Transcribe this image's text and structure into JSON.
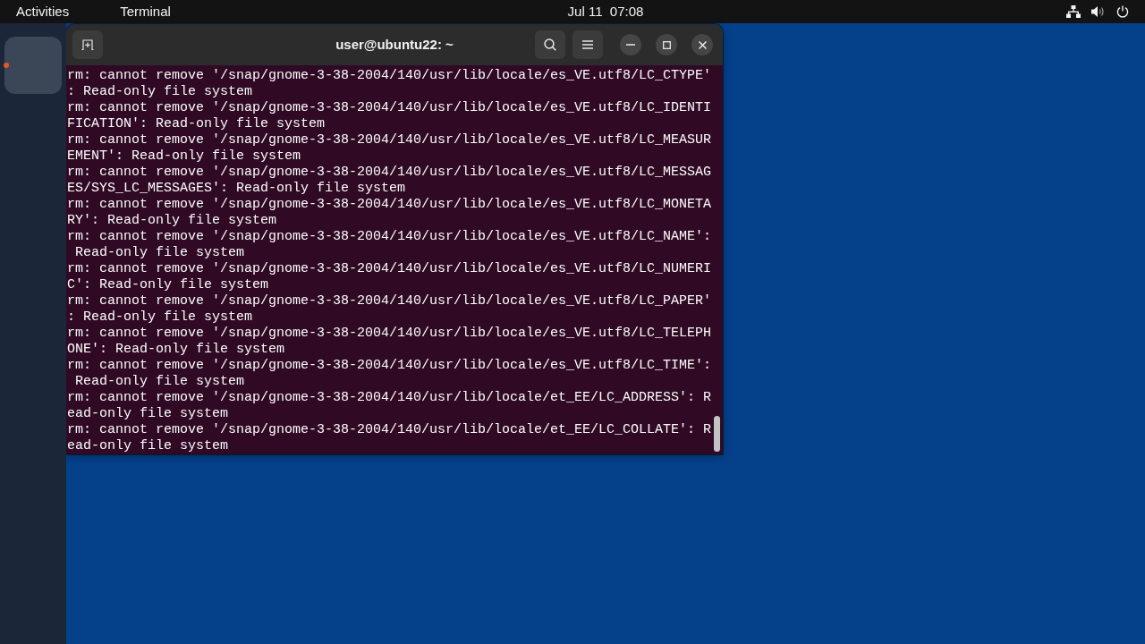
{
  "top_bar": {
    "activities": "Activities",
    "app_menu": "Terminal",
    "clock": "Jul 11  07:08"
  },
  "dock": {
    "apps": [
      {
        "selected": true,
        "running": true
      }
    ]
  },
  "terminal": {
    "title": "user@ubuntu22: ~",
    "lines": [
      "rm: cannot remove '/snap/gnome-3-38-2004/140/usr/lib/locale/es_VE.utf8/LC_CTYPE'",
      ": Read-only file system",
      "rm: cannot remove '/snap/gnome-3-38-2004/140/usr/lib/locale/es_VE.utf8/LC_IDENTI",
      "FICATION': Read-only file system",
      "rm: cannot remove '/snap/gnome-3-38-2004/140/usr/lib/locale/es_VE.utf8/LC_MEASUR",
      "EMENT': Read-only file system",
      "rm: cannot remove '/snap/gnome-3-38-2004/140/usr/lib/locale/es_VE.utf8/LC_MESSAG",
      "ES/SYS_LC_MESSAGES': Read-only file system",
      "rm: cannot remove '/snap/gnome-3-38-2004/140/usr/lib/locale/es_VE.utf8/LC_MONETA",
      "RY': Read-only file system",
      "rm: cannot remove '/snap/gnome-3-38-2004/140/usr/lib/locale/es_VE.utf8/LC_NAME':",
      " Read-only file system",
      "rm: cannot remove '/snap/gnome-3-38-2004/140/usr/lib/locale/es_VE.utf8/LC_NUMERI",
      "C': Read-only file system",
      "rm: cannot remove '/snap/gnome-3-38-2004/140/usr/lib/locale/es_VE.utf8/LC_PAPER'",
      ": Read-only file system",
      "rm: cannot remove '/snap/gnome-3-38-2004/140/usr/lib/locale/es_VE.utf8/LC_TELEPH",
      "ONE': Read-only file system",
      "rm: cannot remove '/snap/gnome-3-38-2004/140/usr/lib/locale/es_VE.utf8/LC_TIME':",
      " Read-only file system",
      "rm: cannot remove '/snap/gnome-3-38-2004/140/usr/lib/locale/et_EE/LC_ADDRESS': R",
      "ead-only file system",
      "rm: cannot remove '/snap/gnome-3-38-2004/140/usr/lib/locale/et_EE/LC_COLLATE': R",
      "ead-only file system"
    ]
  }
}
